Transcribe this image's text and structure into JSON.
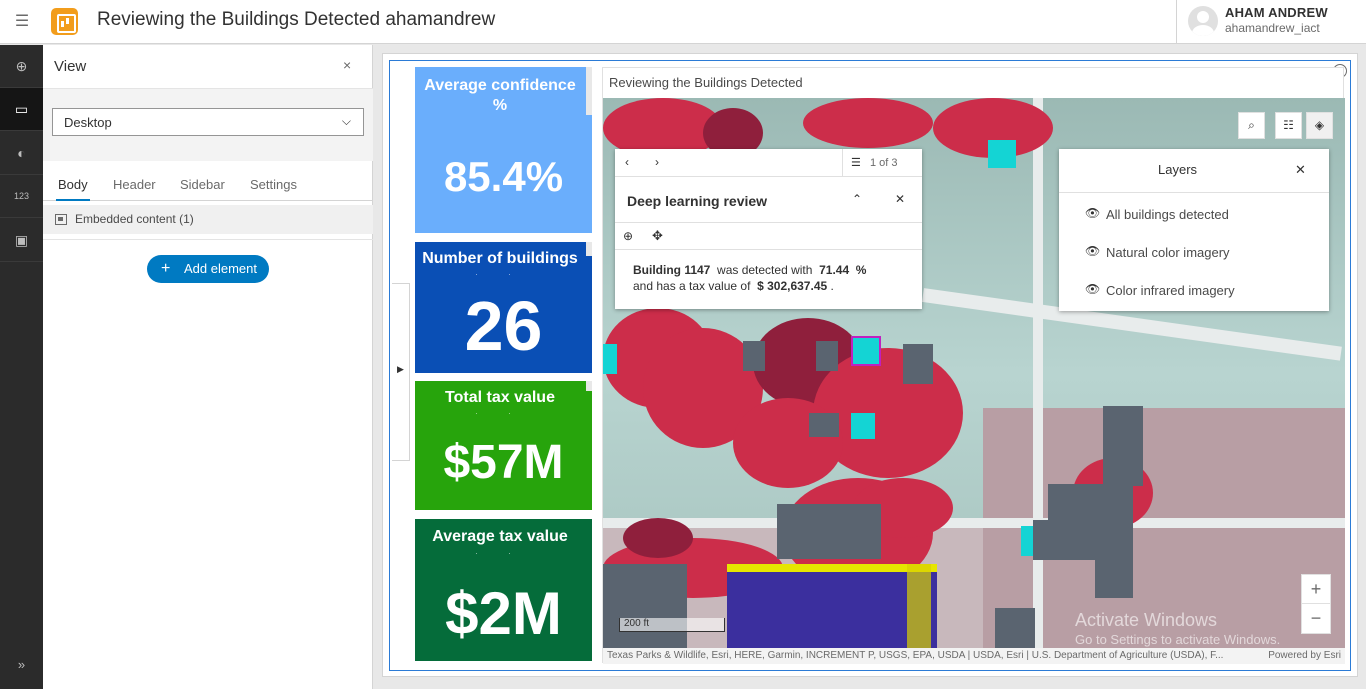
{
  "header": {
    "title": "Reviewing the Buildings Detected ahamandrew",
    "user_name": "AHAM ANDREW",
    "user_handle": "ahamandrew_iact"
  },
  "rail": {
    "items": [
      "add-icon",
      "desktop-icon",
      "theme-icon",
      "number-icon",
      "save-icon"
    ],
    "number_label": "123",
    "expand_label": "»"
  },
  "view_panel": {
    "title": "View",
    "close_label": "×",
    "device_select": "Desktop",
    "tabs": [
      "Body",
      "Header",
      "Sidebar",
      "Settings"
    ],
    "content_item": "Embedded content (1)",
    "add_element_label": "Add element"
  },
  "indicators": [
    {
      "title": "Average confidence %",
      "value": "85.4%",
      "color": "#6aaefc"
    },
    {
      "title": "Number of buildings",
      "value": "26",
      "color": "#0a4fb5"
    },
    {
      "title": "Total tax value",
      "value": "$57M",
      "color": "#27a40c"
    },
    {
      "title": "Average tax value",
      "value": "$2M",
      "color": "#056c3a"
    }
  ],
  "map": {
    "title": "Reviewing the Buildings Detected",
    "popup": {
      "pager": "1 of 3",
      "title": "Deep learning review",
      "building_label": "Building 1147",
      "detected_text": "was detected with",
      "confidence": "71.44",
      "percent": "%",
      "tax_text": "and has a tax value of",
      "tax_value": "$ 302,637.45",
      "end": "."
    },
    "layers": {
      "title": "Layers",
      "items": [
        "All buildings detected",
        "Natural color imagery",
        "Color infrared imagery"
      ]
    },
    "scalebar": "200 ft",
    "attribution": "Texas Parks & Wildlife, Esri, HERE, Garmin, INCREMENT P, USGS, EPA, USDA | USDA, Esri | U.S. Department of Agriculture (USDA), F...",
    "powered_by": "Powered by Esri",
    "watermark_line1": "Activate Windows",
    "watermark_line2": "Go to Settings to activate Windows."
  }
}
